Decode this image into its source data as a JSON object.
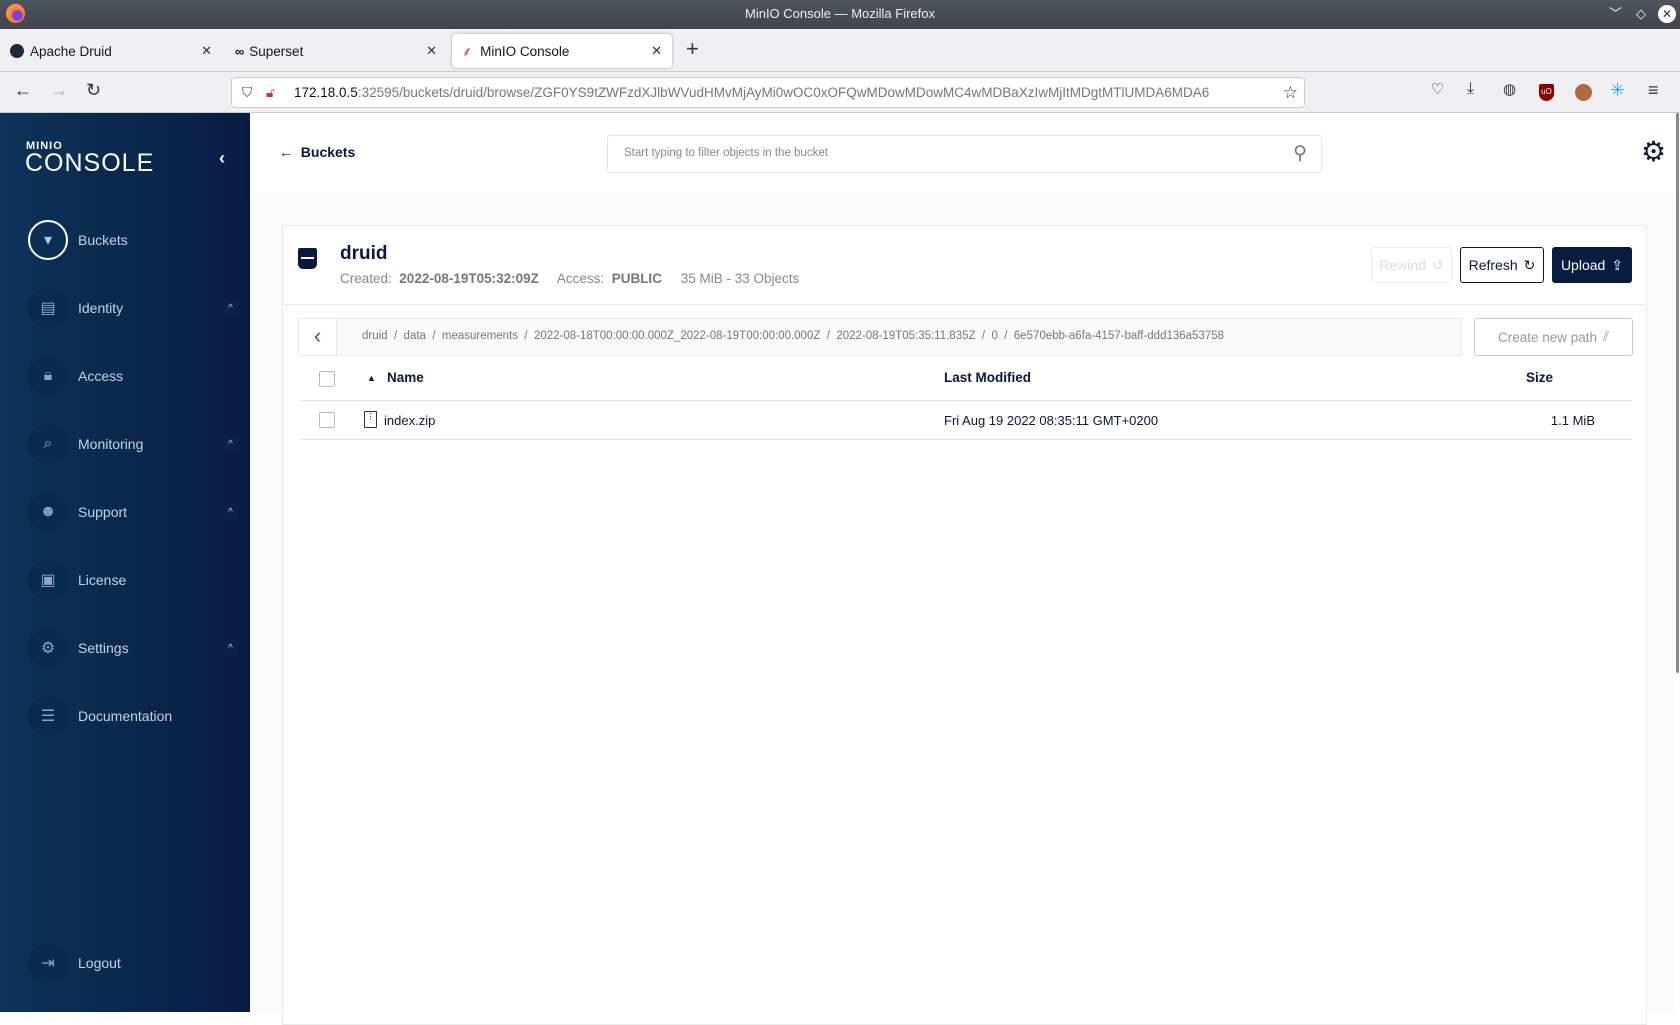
{
  "window": {
    "title": "MinIO Console — Mozilla Firefox"
  },
  "tabs": [
    {
      "label": "Apache Druid"
    },
    {
      "label": "Superset"
    },
    {
      "label": "MinIO Console",
      "active": true
    }
  ],
  "url": {
    "host": "172.18.0.5",
    "rest": ":32595/buckets/druid/browse/ZGF0YS9tZWFzdXJlbWVudHMvMjAyMi0wOC0xOFQwMDowMDowMC4wMDBaXzIwMjItMDgtMTlUMDA6MDA6"
  },
  "sidebar": {
    "logo_top": "MINIO",
    "logo_bottom": "CONSOLE",
    "items": [
      {
        "label": "Buckets",
        "icon": "bucket-icon"
      },
      {
        "label": "Identity",
        "icon": "id-card-icon"
      },
      {
        "label": "Access",
        "icon": "lock-icon"
      },
      {
        "label": "Monitoring",
        "icon": "magnifier-icon"
      },
      {
        "label": "Support",
        "icon": "support-icon"
      },
      {
        "label": "License",
        "icon": "license-icon"
      },
      {
        "label": "Settings",
        "icon": "gear-icon"
      },
      {
        "label": "Documentation",
        "icon": "document-icon"
      },
      {
        "label": "Logout",
        "icon": "logout-icon"
      }
    ]
  },
  "header": {
    "back_label": "Buckets",
    "search_placeholder": "Start typing to filter objects in the bucket"
  },
  "bucket": {
    "name": "druid",
    "created_label": "Created:",
    "created": "2022-08-19T05:32:09Z",
    "access_label": "Access:",
    "access": "PUBLIC",
    "usage": "35 MiB - 33 Objects",
    "rewind_label": "Rewind",
    "refresh_label": "Refresh",
    "upload_label": "Upload"
  },
  "breadcrumb": "druid  /  data  /  measurements  /  2022-08-18T00:00:00.000Z_2022-08-19T00:00:00.000Z  /  2022-08-19T05:35:11.835Z  /  0  /  6e570ebb-a6fa-4157-baff-ddd136a53758",
  "create_path_label": "Create new path",
  "table": {
    "columns": [
      "Name",
      "Last Modified",
      "Size"
    ],
    "rows": [
      {
        "name": "index.zip",
        "modified": "Fri Aug 19 2022 08:35:11 GMT+0200",
        "size": "1.1 MiB"
      }
    ]
  },
  "colors": {
    "sidebar": "#0d3358",
    "primary": "#081c42"
  }
}
